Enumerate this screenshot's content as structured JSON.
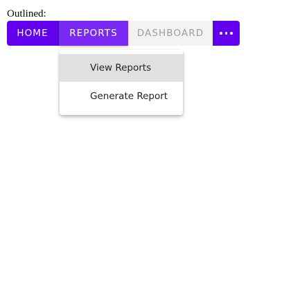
{
  "caption": "Outlined:",
  "button_group": {
    "home_label": "HOME",
    "reports_label": "REPORTS",
    "dashboard_label": "DASHBOARD",
    "more_icon": "more-horizontal-icon"
  },
  "dropdown_menu": {
    "items": [
      {
        "label": "View Reports",
        "highlighted": true
      },
      {
        "label": "Generate Report",
        "highlighted": false
      }
    ]
  },
  "colors": {
    "primary": "#6200ee",
    "reports_active": "#7a29f4",
    "dashboard_disabled_bg": "#f3f3f3",
    "dashboard_disabled_text": "#9e9e9e",
    "menu_highlight": "#e0e0e0"
  }
}
